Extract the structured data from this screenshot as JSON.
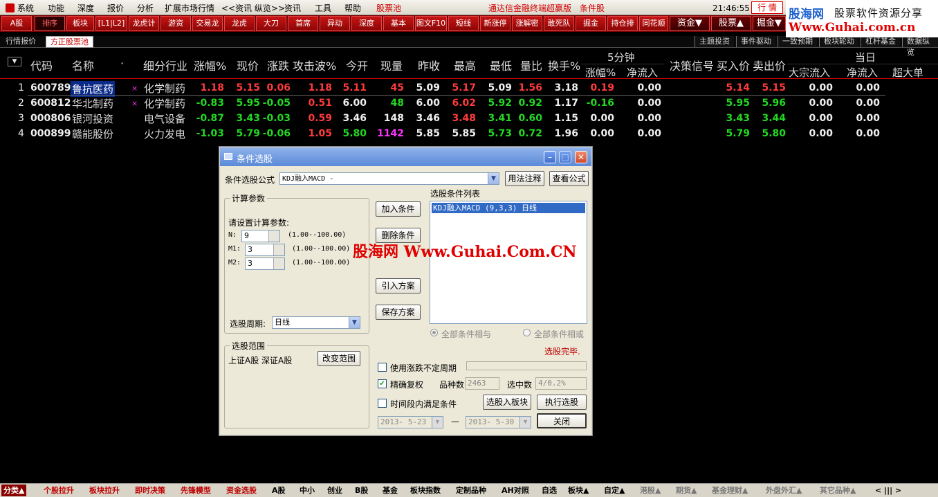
{
  "menubar": {
    "items": [
      "系统",
      "功能",
      "深度",
      "报价",
      "分析",
      "扩展市场行情",
      "<<资讯 纵览>>",
      "资讯",
      "工具",
      "帮助",
      "股票池"
    ],
    "title": "通达信金融终端超赢版",
    "condition": "条件股",
    "clock": "21:46:55 周四",
    "hq_button": "行 情"
  },
  "logo": {
    "site_cn": "股海网",
    "tagline": "股票软件资源分享",
    "url": "Www.Guhai.com.cn"
  },
  "toolbar": {
    "buttons": [
      "A股",
      "板块",
      "[L1|L2]",
      "龙虎计",
      "游资",
      "交易龙",
      "龙虎",
      "大刀",
      "首席",
      "异动",
      "深度",
      "基本",
      "图文F10",
      "短线",
      "新涨停",
      "涨解密",
      "敢死队",
      "掘金",
      "持仓排",
      "同花顺"
    ],
    "active": "排序",
    "right": [
      "资金▼",
      "股票▲",
      "掘金▼"
    ]
  },
  "tabs": {
    "left": [
      "行情报价",
      "方正股票池"
    ],
    "right": [
      "主题投资",
      "事件驱动",
      "一致预期",
      "板块轮动",
      "杠杆基金",
      "数据纵览"
    ]
  },
  "table": {
    "headers": {
      "code": "代码",
      "name": "名称",
      "dot": "·",
      "industry": "细分行业",
      "pct": "涨幅%",
      "price": "现价",
      "chg": "涨跌",
      "attack": "攻击波%",
      "open": "今开",
      "vol": "现量",
      "prev": "昨收",
      "high": "最高",
      "low": "最低",
      "ratio": "量比",
      "turnover": "换手%",
      "five_min": "5分钟",
      "five_pct": "涨幅%",
      "five_net": "净流入",
      "signal": "决策信号",
      "buy": "买入价",
      "sell": "卖出价",
      "today": "当日",
      "bigflow": "大宗流入",
      "netin": "净流入",
      "super": "超大单"
    },
    "rows": [
      {
        "idx": "1",
        "code": "600789",
        "name": "鲁抗医药",
        "mark": "×",
        "industry": "化学制药",
        "pct": "1.18",
        "price": "5.15",
        "chg": "0.06",
        "attack": "1.18",
        "open": "5.11",
        "vol": "45",
        "prev": "5.09",
        "high": "5.17",
        "low": "5.09",
        "ratio": "1.56",
        "turnover": "3.18",
        "f5pct": "0.19",
        "f5net": "0.00",
        "buy": "5.14",
        "sell": "5.15",
        "bigflow": "0.00",
        "netin": "0.00"
      },
      {
        "idx": "2",
        "code": "600812",
        "name": "华北制药",
        "mark": "×",
        "industry": "化学制药",
        "pct": "-0.83",
        "price": "5.95",
        "chg": "-0.05",
        "attack": "0.51",
        "open": "6.00",
        "vol": "48",
        "prev": "6.00",
        "high": "6.02",
        "low": "5.92",
        "ratio": "0.92",
        "turnover": "1.17",
        "f5pct": "-0.16",
        "f5net": "0.00",
        "buy": "5.95",
        "sell": "5.96",
        "bigflow": "0.00",
        "netin": "0.00"
      },
      {
        "idx": "3",
        "code": "000806",
        "name": "银河投资",
        "mark": "",
        "industry": "电气设备",
        "pct": "-0.87",
        "price": "3.43",
        "chg": "-0.03",
        "attack": "0.59",
        "open": "3.46",
        "vol": "148",
        "prev": "3.46",
        "high": "3.48",
        "low": "3.41",
        "ratio": "0.60",
        "turnover": "1.15",
        "f5pct": "0.00",
        "f5net": "0.00",
        "buy": "3.43",
        "sell": "3.44",
        "bigflow": "0.00",
        "netin": "0.00"
      },
      {
        "idx": "4",
        "code": "000899",
        "name": "赣能股份",
        "mark": "",
        "industry": "火力发电",
        "pct": "-1.03",
        "price": "5.79",
        "chg": "-0.06",
        "attack": "1.05",
        "open": "5.80",
        "vol": "1142",
        "prev": "5.85",
        "high": "5.85",
        "low": "5.73",
        "ratio": "0.72",
        "turnover": "1.96",
        "f5pct": "0.00",
        "f5net": "0.00",
        "buy": "5.79",
        "sell": "5.80",
        "bigflow": "0.00",
        "netin": "0.00"
      }
    ]
  },
  "dialog": {
    "title": "条件选股",
    "formula_label": "条件选股公式",
    "formula_value": "KDJ融入MACD -",
    "usage_btn": "用法注释",
    "view_btn": "查看公式",
    "params_group": "计算参数",
    "params_hint": "请设置计算参数:",
    "params": [
      {
        "name": "N:",
        "value": "9",
        "range": "(1.00--100.00)"
      },
      {
        "name": "M1:",
        "value": "3",
        "range": "(1.00--100.00)"
      },
      {
        "name": "M2:",
        "value": "3",
        "range": "(1.00--100.00)"
      }
    ],
    "period_label": "选股周期:",
    "period_value": "日线",
    "add_btn": "加入条件",
    "del_btn": "删除条件",
    "import_btn": "引入方案",
    "save_btn": "保存方案",
    "list_title": "选股条件列表",
    "list_item": "KDJ融入MACD (9,3,3) 日线",
    "radio_and": "全部条件相与",
    "radio_or": "全部条件相或",
    "status": "选股完毕.",
    "range_group": "选股范围",
    "range_value": "上证A股 深证A股",
    "range_btn": "改变范围",
    "opt_period": "使用涨跌不定周期",
    "opt_adjust": "精确复权",
    "opt_time": "时间段内满足条件",
    "count_label": "品种数",
    "count_value": "2463",
    "hit_label": "选中数",
    "hit_value": "4/0.2%",
    "to_block_btn": "选股入板块",
    "run_btn": "执行选股",
    "close_btn": "关闭",
    "date_from": "2013- 5-23",
    "date_to": "2013- 5-30",
    "dash": "—"
  },
  "watermark": "股海网 Www.Guhai.Com.CN",
  "bottom": {
    "items": [
      "分类▲",
      "个股拉升",
      "板块拉升",
      "即时决策",
      "先锋模型",
      "资金选股",
      "A股",
      "中小",
      "创业",
      "B股",
      "基金",
      "板块指数",
      "定制品种",
      "AH对照",
      "自选",
      "板块▲",
      "自定▲",
      "港股▲",
      "期货▲",
      "基金理财▲",
      "外盘外汇▲",
      "其它品种▲"
    ],
    "arrows": "<  |||  >"
  }
}
